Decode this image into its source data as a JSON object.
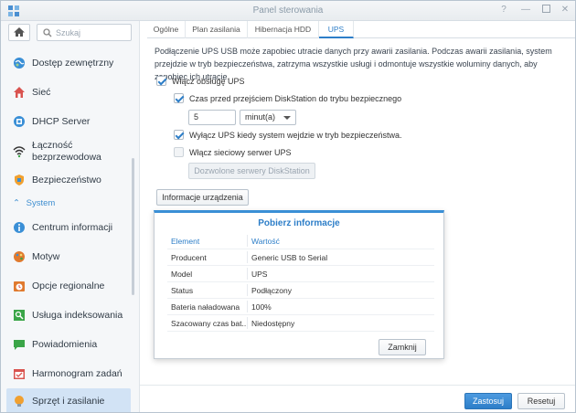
{
  "window": {
    "title": "Panel sterowania",
    "controls": [
      "help-icon",
      "minimize-icon",
      "maximize-icon",
      "close-icon"
    ]
  },
  "sidebar": {
    "search_placeholder": "Szukaj",
    "items": [
      {
        "label": "Dostęp zewnętrzny",
        "icon": "globe-icon",
        "color": "#3a8fd6"
      },
      {
        "label": "Sieć",
        "icon": "home-network-icon",
        "color": "#d9534f"
      },
      {
        "label": "DHCP Server",
        "icon": "dhcp-icon",
        "color": "#3a8fd6"
      },
      {
        "label": "Łączność bezprzewodowa",
        "icon": "wifi-icon",
        "color": "#333333"
      },
      {
        "label": "Bezpieczeństwo",
        "icon": "shield-icon",
        "color": "#f0a030"
      }
    ],
    "section_header": "System",
    "system_items": [
      {
        "label": "Centrum informacji",
        "icon": "info-icon",
        "color": "#3a8fd6"
      },
      {
        "label": "Motyw",
        "icon": "palette-icon",
        "color": "#e07a2e"
      },
      {
        "label": "Opcje regionalne",
        "icon": "clock-region-icon",
        "color": "#e07a2e"
      },
      {
        "label": "Usługa indeksowania",
        "icon": "index-icon",
        "color": "#3aa548"
      },
      {
        "label": "Powiadomienia",
        "icon": "chat-icon",
        "color": "#3aa548"
      },
      {
        "label": "Harmonogram zadań",
        "icon": "calendar-icon",
        "color": "#d9534f"
      },
      {
        "label": "Sprzęt i zasilanie",
        "icon": "bulb-icon",
        "color": "#f0a030",
        "active": true
      }
    ]
  },
  "tabs": [
    {
      "label": "Ogólne",
      "active": false
    },
    {
      "label": "Plan zasilania",
      "active": false
    },
    {
      "label": "Hibernacja HDD",
      "active": false
    },
    {
      "label": "UPS",
      "active": true
    }
  ],
  "ups": {
    "description": "Podłączenie UPS USB może zapobiec utracie danych przy awarii zasilania. Podczas awarii zasilania, system przejdzie w tryb bezpieczeństwa, zatrzyma wszystkie usługi i odmontuje wszystkie woluminy danych, aby zapobiec ich utracie.",
    "enable_ups_label": "Włącz obsługę UPS",
    "enable_ups_checked": true,
    "time_label": "Czas przed przejściem DiskStation do trybu bezpiecznego",
    "time_checked": true,
    "time_value": "5",
    "time_unit": "minut(a)",
    "shutdown_label": "Wyłącz UPS kiedy system wejdzie w tryb bezpieczeństwa.",
    "shutdown_checked": true,
    "network_server_label": "Włącz sieciowy serwer UPS",
    "network_server_checked": false,
    "allowed_servers_button": "Dozwolone serwery DiskStation",
    "device_info_button": "Informacje urządzenia"
  },
  "dialog": {
    "title": "Pobierz informacje",
    "col_element": "Element",
    "col_value": "Wartość",
    "rows": [
      {
        "element": "Producent",
        "value": "Generic USB to Serial"
      },
      {
        "element": "Model",
        "value": "UPS"
      },
      {
        "element": "Status",
        "value": "Podłączony"
      },
      {
        "element": "Bateria naładowana",
        "value": "100%"
      },
      {
        "element": "Szacowany czas bat...",
        "value": "Niedostępny"
      }
    ],
    "close_button": "Zamknij"
  },
  "footer": {
    "apply_button": "Zastosuj",
    "reset_button": "Resetuj"
  }
}
